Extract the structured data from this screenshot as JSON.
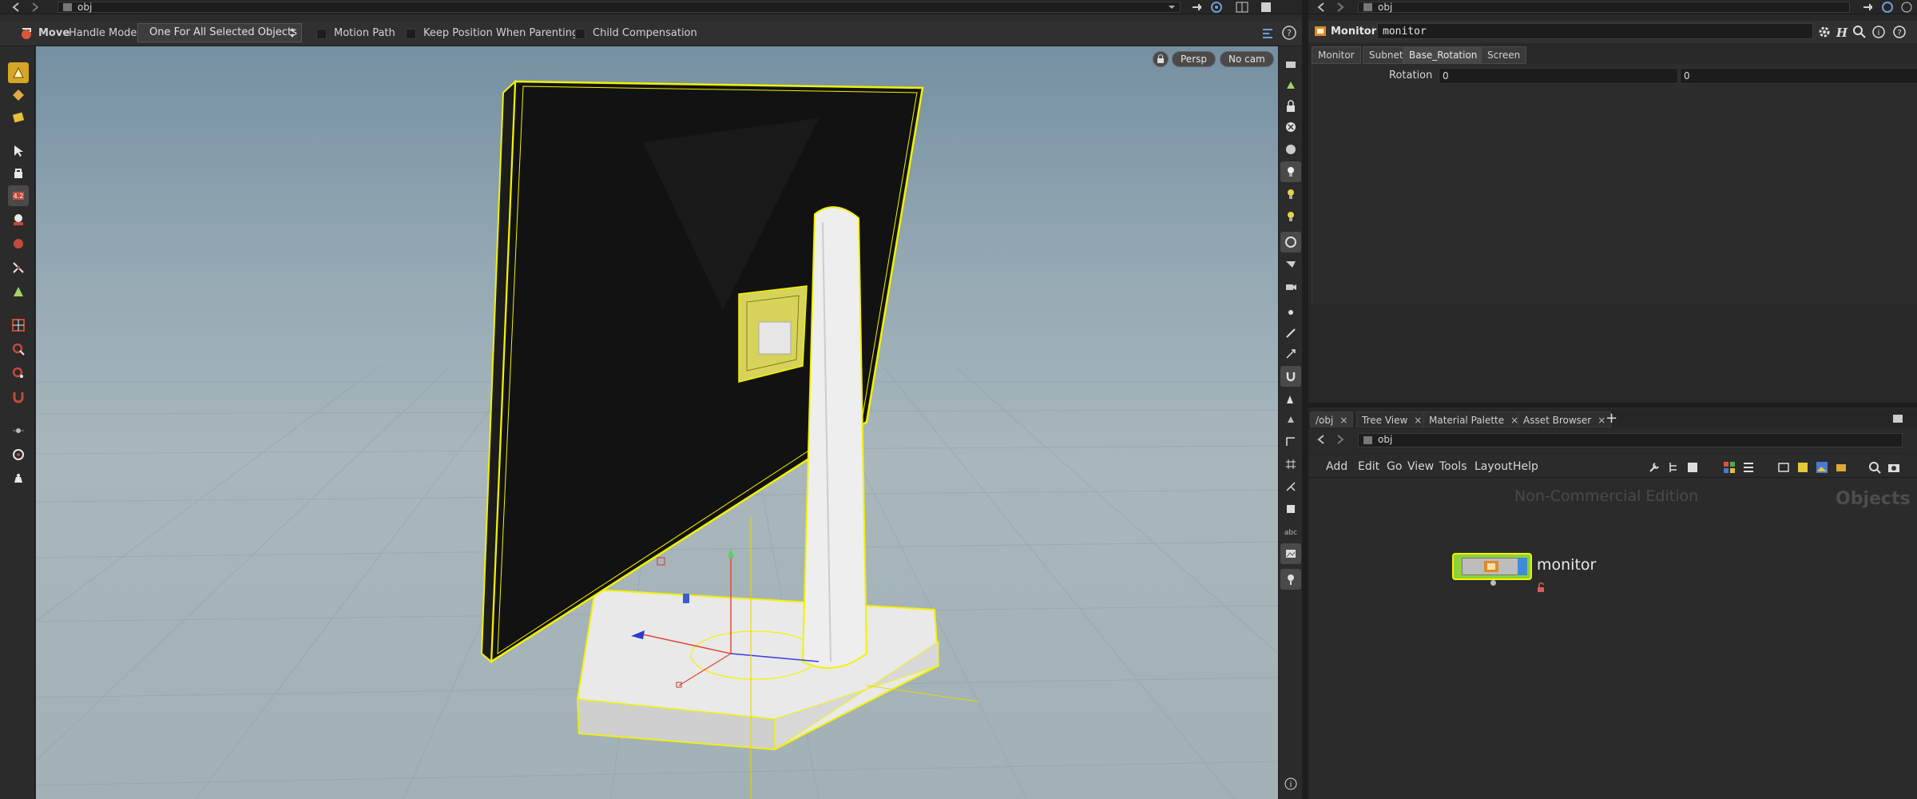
{
  "viewer": {
    "path": "obj",
    "toolbar": {
      "tool_name": "Move",
      "handle_mode_label": "Handle Mode",
      "handle_mode_value": "One For All Selected Objects",
      "motion_path_label": "Motion Path",
      "keep_position_label": "Keep Position When Parenting",
      "child_comp_label": "Child Compensation"
    },
    "viewport": {
      "persp_label": "Persp",
      "cam_label": "No cam"
    }
  },
  "params": {
    "path": "obj",
    "node_type": "Monitor",
    "node_name": "monitor",
    "tabs": [
      "Monitor",
      "Subnet",
      "Base_Rotation",
      "Screen"
    ],
    "active_tab": "Base_Rotation",
    "rotation_label": "Rotation",
    "rotation_values": [
      "0",
      "0"
    ]
  },
  "network": {
    "tabs": [
      "/obj",
      "Tree View",
      "Material Palette",
      "Asset Browser"
    ],
    "path": "obj",
    "menus": [
      "Add",
      "Edit",
      "Go",
      "View",
      "Tools",
      "Layout",
      "Help"
    ],
    "watermark": "Non-Commercial Edition",
    "context_label": "Objects",
    "node_label": "monitor"
  },
  "colors": {
    "selection": "#f2f200",
    "node_body": "#8fd137",
    "node_accent": "#3f8cd6"
  }
}
